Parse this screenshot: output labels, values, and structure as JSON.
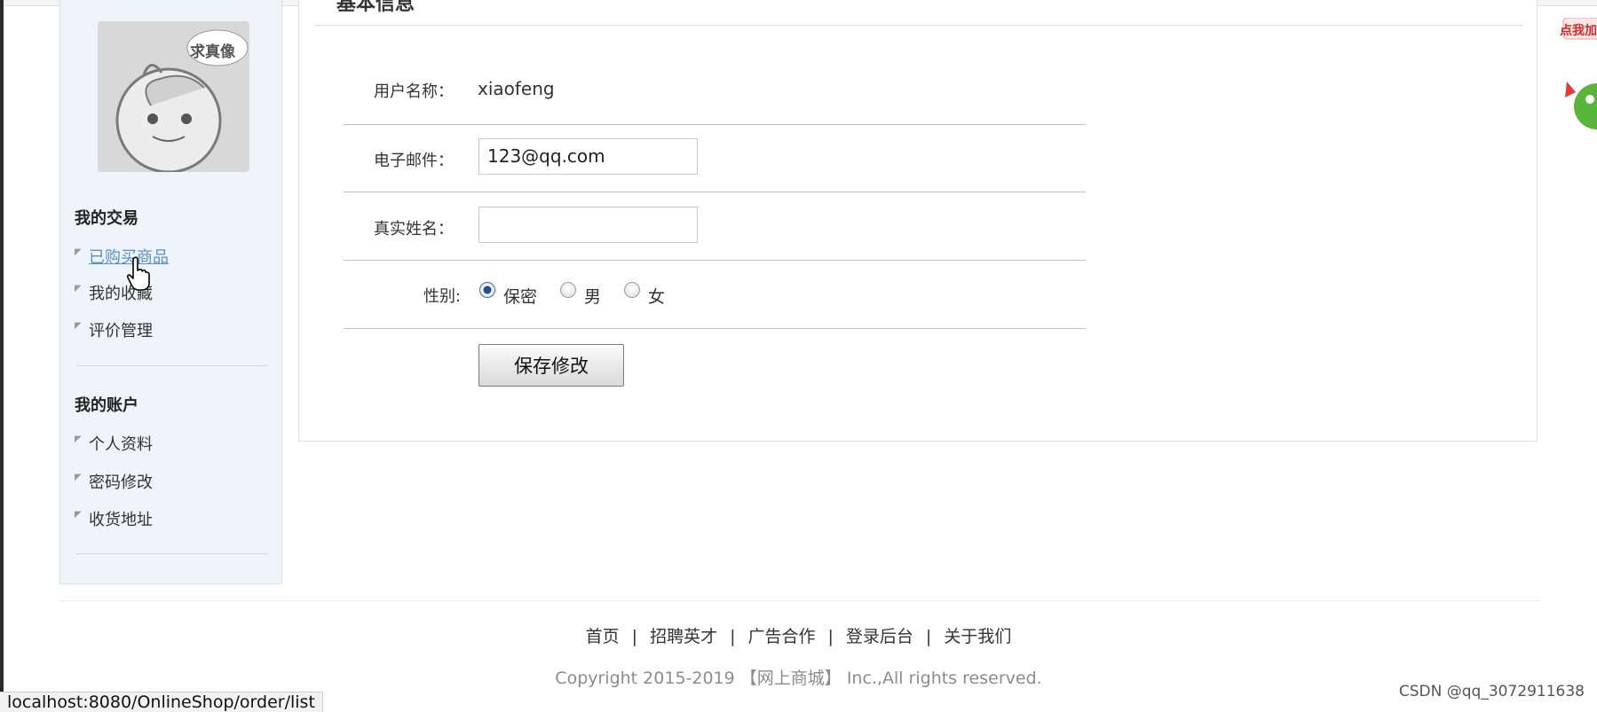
{
  "sidebar": {
    "avatar_badge": "求真像",
    "sections": [
      {
        "title": "我的交易",
        "items": [
          {
            "label": "已购买商品",
            "active": true
          },
          {
            "label": "我的收藏",
            "active": false
          },
          {
            "label": "评价管理",
            "active": false
          }
        ]
      },
      {
        "title": "我的账户",
        "items": [
          {
            "label": "个人资料",
            "active": false
          },
          {
            "label": "密码修改",
            "active": false
          },
          {
            "label": "收货地址",
            "active": false
          }
        ]
      }
    ]
  },
  "panel": {
    "title": "基本信息",
    "form": {
      "username_label": "用户名称：",
      "username_value": "xiaofeng",
      "email_label": "电子邮件：",
      "email_value": "123@qq.com",
      "realname_label": "真实姓名：",
      "realname_value": "",
      "gender_label": "性别:",
      "gender_options": [
        {
          "label": "保密",
          "checked": true
        },
        {
          "label": "男",
          "checked": false
        },
        {
          "label": "女",
          "checked": false
        }
      ],
      "save_label": "保存修改"
    }
  },
  "footer": {
    "links": [
      "首页",
      "招聘英才",
      "广告合作",
      "登录后台",
      "关于我们"
    ],
    "separator": "|",
    "copyright": "Copyright 2015-2019 【网上商城】 Inc.,All rights reserved."
  },
  "status_bar": {
    "url": "localhost:8080/OnlineShop/order/list"
  },
  "watermark": "CSDN @qq_3072911638",
  "mascot_text": "点我加",
  "colors": {
    "active_link": "#5a8fc4",
    "sidebar_bg": "#eef4fa",
    "radio_checked": "#1f4f8c"
  }
}
